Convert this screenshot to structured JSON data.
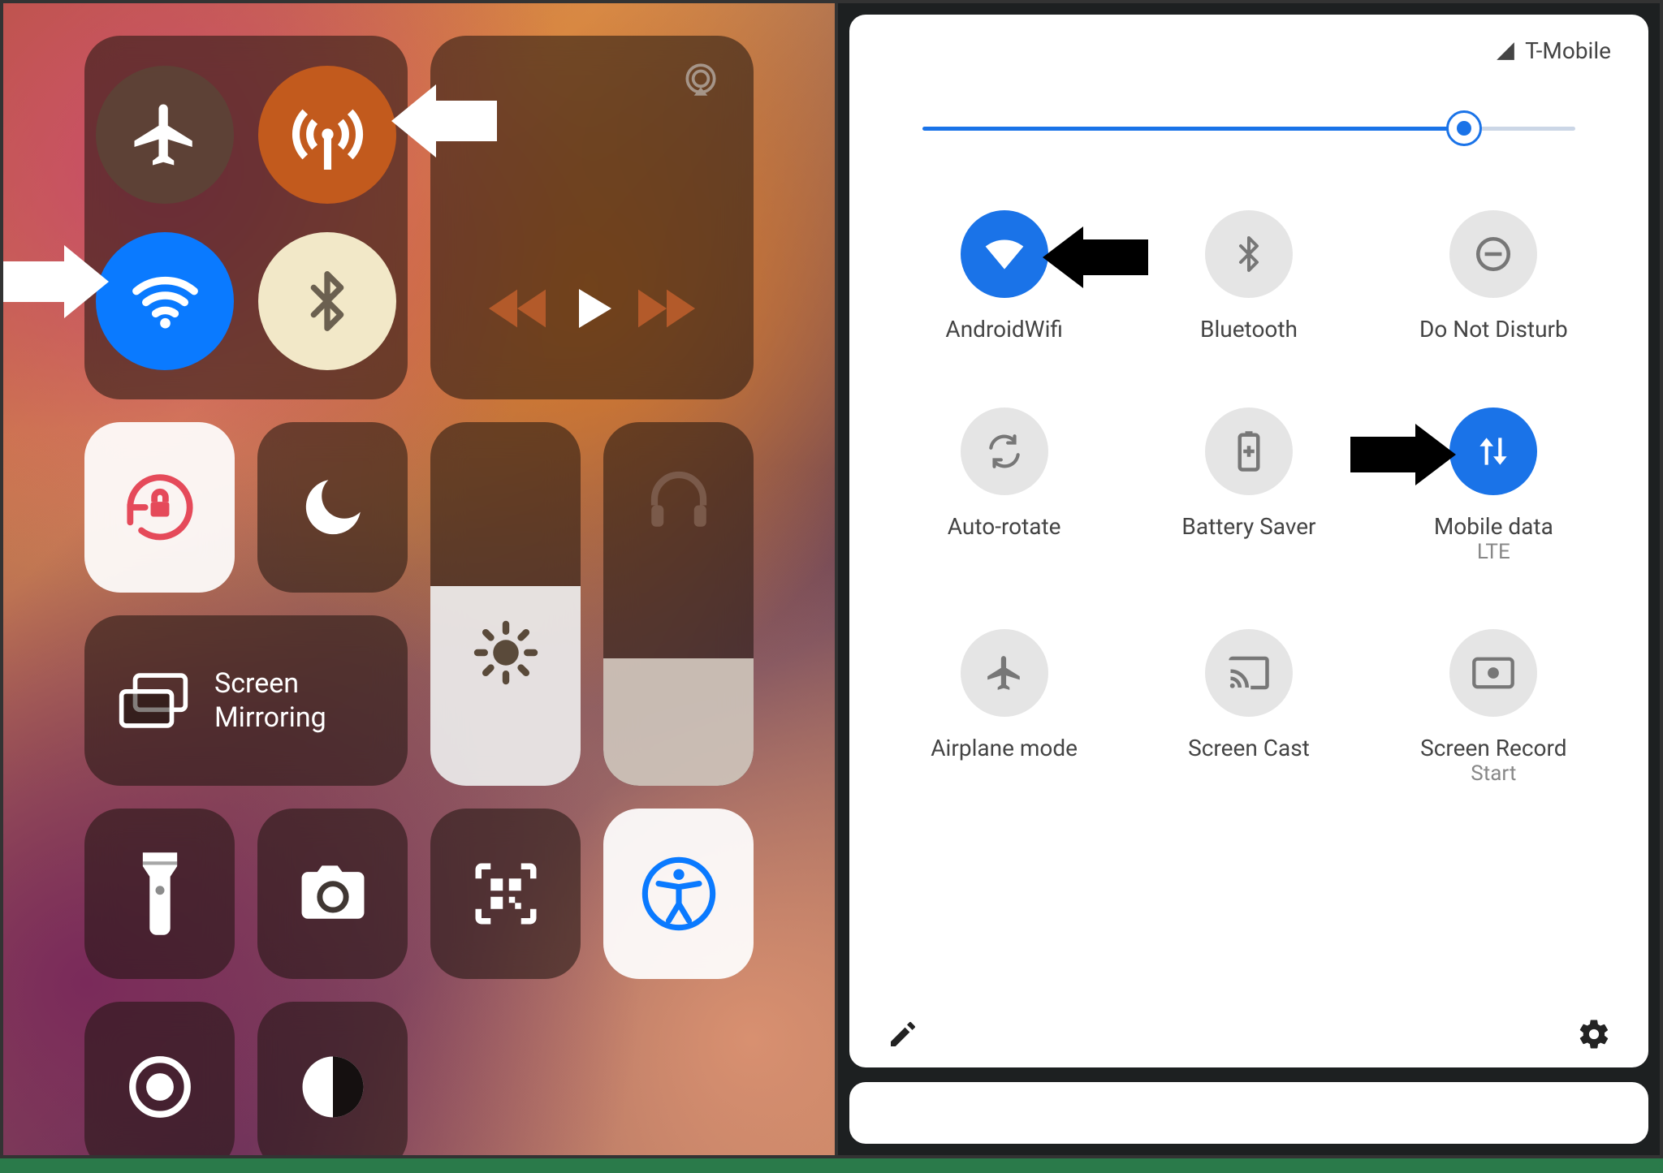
{
  "ios": {
    "screen_mirroring_line1": "Screen",
    "screen_mirroring_line2": "Mirroring",
    "airplane_on": false,
    "cellular_on": true,
    "wifi_on": true,
    "bluetooth_on": true,
    "brightness_percent": 55,
    "volume_percent": 35,
    "pointers": [
      "cellular-toggle",
      "wifi-toggle"
    ]
  },
  "android": {
    "carrier": "T-Mobile",
    "brightness_percent": 83,
    "tiles": [
      {
        "id": "wifi",
        "label": "AndroidWifi",
        "sub": "",
        "on": true
      },
      {
        "id": "bluetooth",
        "label": "Bluetooth",
        "sub": "",
        "on": false
      },
      {
        "id": "dnd",
        "label": "Do Not Disturb",
        "sub": "",
        "on": false
      },
      {
        "id": "autorotate",
        "label": "Auto-rotate",
        "sub": "",
        "on": false
      },
      {
        "id": "battery",
        "label": "Battery Saver",
        "sub": "",
        "on": false
      },
      {
        "id": "mobiledata",
        "label": "Mobile data",
        "sub": "LTE",
        "on": true
      },
      {
        "id": "airplane",
        "label": "Airplane mode",
        "sub": "",
        "on": false
      },
      {
        "id": "screencast",
        "label": "Screen Cast",
        "sub": "",
        "on": false
      },
      {
        "id": "screenrecord",
        "label": "Screen Record",
        "sub": "Start",
        "on": false
      }
    ],
    "pointers": [
      "wifi",
      "mobiledata"
    ]
  }
}
